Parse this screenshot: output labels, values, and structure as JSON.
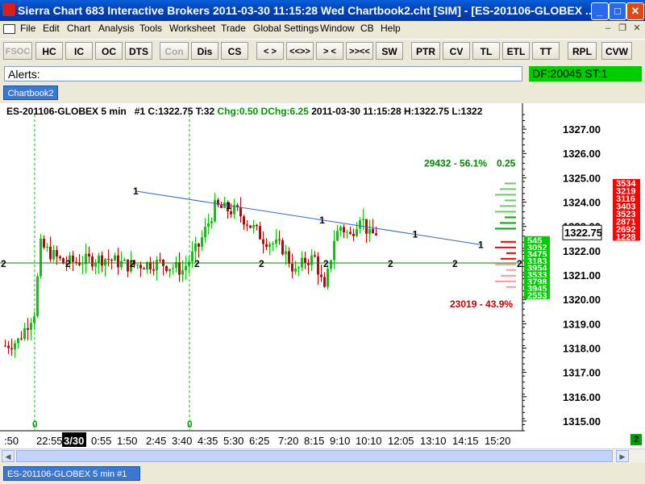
{
  "window": {
    "title": "Sierra Chart 683 Interactive Brokers 2011-03-30  11:15:28  Wed   Chartbook2.cht [SIM] - [ES-201106-GLOBEX ..."
  },
  "menu": {
    "items": [
      "File",
      "Edit",
      "Chart",
      "Analysis",
      "Tools",
      "Worksheet",
      "Trade",
      "Global Settings",
      "Window",
      "CB",
      "Help"
    ]
  },
  "toolbar": {
    "buttons": [
      "FSOC",
      "HC",
      "IC",
      "OC",
      "DTS",
      "Con",
      "Dis",
      "CS",
      "< >",
      "<<>>",
      "> <",
      ">><<",
      "SW",
      "PTR",
      "CV",
      "TL",
      "ETL",
      "TT",
      "RPL",
      "CVW"
    ]
  },
  "alerts": {
    "label": "Alerts:",
    "status": "DF:20045  ST:1"
  },
  "tabs": {
    "chartbook": "Chartbook2",
    "bottom": "ES-201106-GLOBEX  5 min   #1"
  },
  "chart_header": {
    "symbol": "ES-201106-GLOBEX  5 min",
    "info": "#1 C:1322.75 T:32",
    "chg": "Chg:0.50",
    "dchg": "DChg:6.25",
    "rest": "2011-03-30  11:15:28  H:1322.75  L:1322"
  },
  "scroll_badge": "2",
  "colors": {
    "up": "#00cc00",
    "down": "#cc0000",
    "trend": "#3366cc",
    "pivot": "#008800",
    "ask": "#ff0000",
    "bid": "#00cc00"
  },
  "chart_data": {
    "type": "candlestick",
    "ylim": [
      1314.6,
      1327.6
    ],
    "ytick_labels": [
      "1327.00",
      "1326.00",
      "1325.00",
      "1324.00",
      "1323.00",
      "1322.00",
      "1321.00",
      "1320.00",
      "1319.00",
      "1318.00",
      "1317.00",
      "1316.00",
      "1315.00"
    ],
    "yticks": [
      1327,
      1326,
      1325,
      1324,
      1323,
      1322,
      1321,
      1320,
      1319,
      1318,
      1317,
      1316,
      1315
    ],
    "xtick_labels": [
      ":50",
      "22:55",
      "3/30",
      "0:55",
      "1:50",
      "2:45",
      "3:40",
      "4:35",
      "5:30",
      "6:25",
      "7:20",
      "8:15",
      "9:10",
      "10:10",
      "12:05",
      "13:10",
      "14:15",
      "15:20"
    ],
    "xtick_positions": [
      0,
      10,
      19,
      27,
      35,
      44,
      52,
      60,
      68,
      76,
      85,
      93,
      101,
      109,
      119,
      129,
      139,
      149
    ],
    "bar_count": 154,
    "last_price": "1322.75",
    "ask_stack": [
      "3534",
      "3219",
      "3116",
      "3403",
      "3523",
      "2871",
      "2692",
      "1228"
    ],
    "bid_stack": [
      "545",
      "3052",
      "3475",
      "3183",
      "3954",
      "3533",
      "3798",
      "3945",
      "2553"
    ],
    "volume_stats": {
      "top": "29432 - 56.1%",
      "top_value": "0.25",
      "bottom": "23019 - 43.9%"
    },
    "pivot_level": 1321.5,
    "pivot_label": "2",
    "trendline": {
      "from_x": 39,
      "from_y": 1324.45,
      "to_x": 92,
      "to_y": 1322.35,
      "label": "1"
    },
    "session_lines": [
      9,
      57
    ],
    "session_label": "0"
  }
}
